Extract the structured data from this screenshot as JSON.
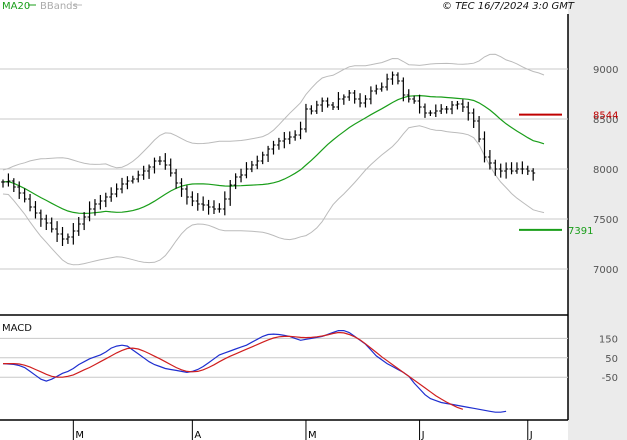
{
  "header": {
    "legend_ma": "MA20",
    "legend_bb": "BBands",
    "copyright": "© TEC 16/7/2024 3:0 GMT"
  },
  "colors": {
    "price_bars": "#000000",
    "ma20": "#1a9e1a",
    "bbands": "#bbbbbb",
    "resistance": "#c00000",
    "support": "#1a9e1a",
    "macd": "#1f2fd0",
    "signal": "#d01f1f",
    "grid": "#c8c8c8",
    "panel_bg": "#ebebeb"
  },
  "chart_data": [
    {
      "type": "ohlc",
      "ylim": [
        6550,
        9550
      ],
      "yticks": [
        {
          "value": 9000,
          "label": "9000"
        },
        {
          "value": 8500,
          "label": "8500"
        },
        {
          "value": 8000,
          "label": "8000"
        },
        {
          "value": 7500,
          "label": "7500"
        },
        {
          "value": 7000,
          "label": "7000"
        }
      ],
      "xticks": [
        {
          "index": 13,
          "label": "M"
        },
        {
          "index": 35,
          "label": "A"
        },
        {
          "index": 56,
          "label": "M"
        },
        {
          "index": 77,
          "label": "J"
        },
        {
          "index": 97,
          "label": "J"
        }
      ],
      "levels": [
        {
          "name": "resistance",
          "value": 8544,
          "label": "8544"
        },
        {
          "name": "support",
          "value": 7391,
          "label": "7391"
        }
      ],
      "close": [
        7870,
        7880,
        7820,
        7760,
        7700,
        7620,
        7560,
        7500,
        7460,
        7400,
        7350,
        7300,
        7320,
        7380,
        7450,
        7520,
        7600,
        7650,
        7680,
        7720,
        7750,
        7800,
        7850,
        7880,
        7900,
        7940,
        7980,
        8020,
        8080,
        8080,
        8040,
        7960,
        7860,
        7800,
        7720,
        7680,
        7650,
        7640,
        7620,
        7600,
        7600,
        7700,
        7840,
        7920,
        7940,
        8000,
        8040,
        8080,
        8140,
        8200,
        8240,
        8280,
        8300,
        8320,
        8340,
        8400,
        8600,
        8580,
        8640,
        8680,
        8640,
        8620,
        8700,
        8720,
        8760,
        8700,
        8660,
        8700,
        8780,
        8800,
        8820,
        8900,
        8940,
        8880,
        8740,
        8700,
        8680,
        8620,
        8560,
        8560,
        8580,
        8600,
        8600,
        8640,
        8650,
        8620,
        8560,
        8480,
        8300,
        8120,
        8060,
        8000,
        7980,
        8000,
        7980,
        8000,
        8000,
        7980,
        7960
      ],
      "ma20": [
        7790,
        7770,
        7740,
        7710,
        7680,
        7660,
        7640,
        7625,
        7610,
        7600,
        7590,
        7580,
        7585,
        7600,
        7620,
        7650,
        7680,
        7710,
        7740,
        7770,
        7800,
        7830,
        7860,
        7880,
        7890,
        7895,
        7890,
        7880,
        7875,
        7875,
        7880,
        7900,
        7930,
        7960,
        7990,
        8020,
        8050,
        8090,
        8130,
        8170,
        8220,
        8270,
        8320,
        8370,
        8410,
        8440,
        8470,
        8500,
        8520,
        8550,
        8570,
        8590,
        8610,
        8625,
        8640,
        8650,
        8650,
        8650,
        8650,
        8650,
        8650,
        8650,
        8630,
        8600,
        8540,
        8470,
        8410,
        8360,
        8300,
        8250
      ]
    },
    {
      "type": "line",
      "title": "MACD",
      "ylim": [
        -270,
        265
      ],
      "yticks": [
        {
          "value": 150,
          "label": "150"
        },
        {
          "value": 50,
          "label": "50"
        },
        {
          "value": -50,
          "label": "-50"
        }
      ],
      "series": [
        {
          "name": "MACD",
          "values": [
            20,
            18,
            16,
            10,
            0,
            -20,
            -40,
            -60,
            -70,
            -60,
            -45,
            -30,
            -20,
            -5,
            15,
            30,
            45,
            55,
            65,
            80,
            100,
            110,
            115,
            110,
            90,
            70,
            50,
            30,
            15,
            5,
            -5,
            -10,
            -15,
            -20,
            -25,
            -20,
            -10,
            5,
            25,
            45,
            65,
            75,
            85,
            95,
            105,
            115,
            130,
            145,
            160,
            170,
            172,
            170,
            165,
            160,
            150,
            140,
            145,
            150,
            155,
            160,
            170,
            180,
            190,
            190,
            180,
            160,
            140,
            120,
            90,
            60,
            40,
            20,
            5,
            -10,
            -25,
            -45,
            -80,
            -110,
            -140,
            -160,
            -170,
            -180,
            -185,
            -190,
            -195,
            -200,
            -205,
            -210,
            -215,
            -220,
            -225,
            -230,
            -230,
            -225
          ]
        },
        {
          "name": "Signal",
          "values": [
            20,
            20,
            20,
            18,
            12,
            2,
            -10,
            -22,
            -35,
            -45,
            -50,
            -50,
            -45,
            -38,
            -25,
            -12,
            0,
            15,
            30,
            45,
            60,
            75,
            88,
            98,
            100,
            95,
            85,
            72,
            58,
            45,
            30,
            15,
            0,
            -12,
            -20,
            -22,
            -20,
            -12,
            0,
            14,
            30,
            45,
            58,
            70,
            82,
            94,
            106,
            118,
            130,
            142,
            152,
            158,
            160,
            160,
            158,
            155,
            154,
            155,
            158,
            162,
            168,
            175,
            180,
            178,
            170,
            158,
            142,
            122,
            100,
            78,
            55,
            35,
            15,
            -5,
            -25,
            -45,
            -65,
            -85,
            -105,
            -125,
            -145,
            -162,
            -178,
            -192,
            -205,
            -215
          ]
        }
      ]
    }
  ]
}
